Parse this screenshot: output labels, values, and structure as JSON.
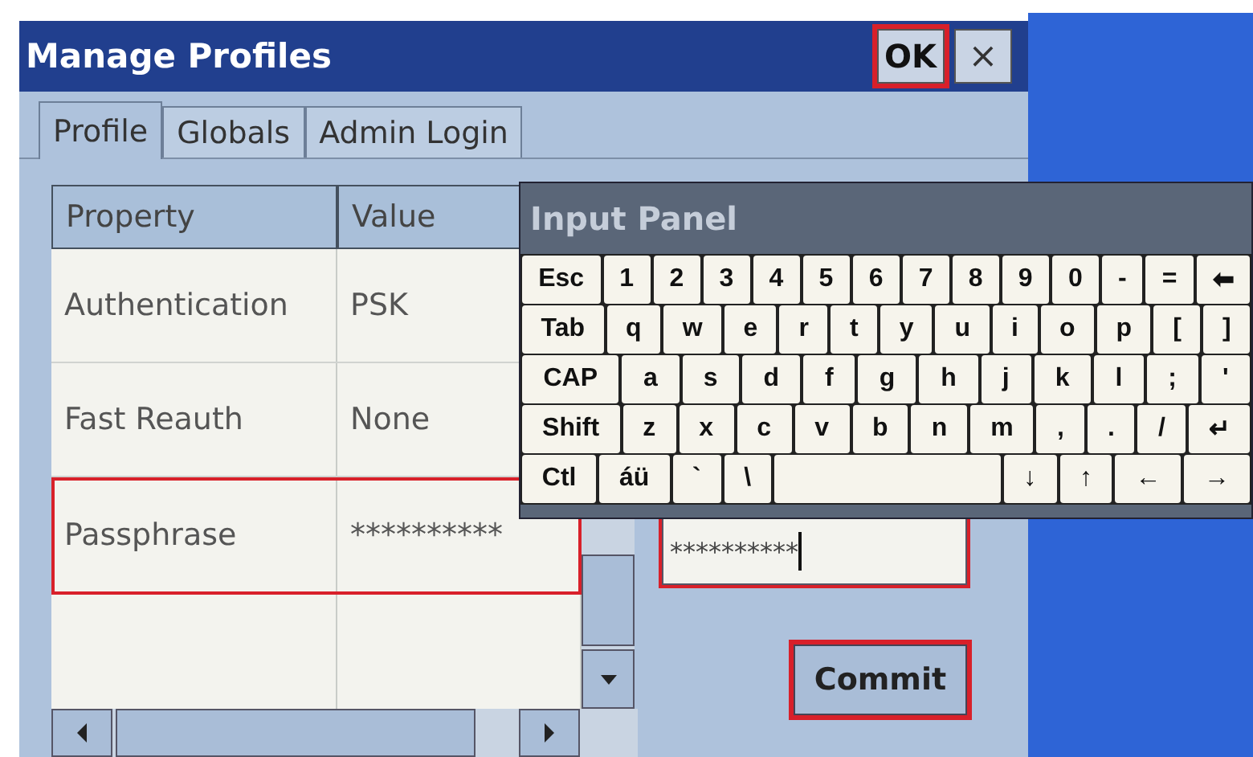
{
  "window": {
    "title": "Manage Profiles",
    "ok_button": {
      "label": "OK",
      "highlighted": true
    },
    "close_button": {
      "label": "×"
    }
  },
  "tabs": [
    {
      "label": "Profile",
      "selected": true
    },
    {
      "label": "Globals",
      "selected": false
    },
    {
      "label": "Admin Login",
      "selected": false
    }
  ],
  "table": {
    "columns": [
      "Property",
      "Value"
    ],
    "rows": [
      {
        "cells": [
          "Authentication",
          "PSK"
        ],
        "highlighted": false
      },
      {
        "cells": [
          "Fast Reauth",
          "None"
        ],
        "highlighted": false
      },
      {
        "cells": [
          "Passphrase",
          "**********"
        ],
        "highlighted": true
      }
    ]
  },
  "passphrase_field": {
    "value": "**********",
    "highlighted": true
  },
  "commit_button": {
    "label": "Commit",
    "highlighted": true
  },
  "input_panel": {
    "title": "Input Panel",
    "key_rows": [
      {
        "keys": [
          {
            "kind": "key",
            "label": "Esc"
          },
          {
            "kind": "key",
            "label": "1"
          },
          {
            "kind": "key",
            "label": "2"
          },
          {
            "kind": "key",
            "label": "3"
          },
          {
            "kind": "key",
            "label": "4"
          },
          {
            "kind": "key",
            "label": "5"
          },
          {
            "kind": "key",
            "label": "6"
          },
          {
            "kind": "key",
            "label": "7"
          },
          {
            "kind": "key",
            "label": "8"
          },
          {
            "kind": "key",
            "label": "9"
          },
          {
            "kind": "key",
            "label": "0"
          },
          {
            "kind": "key",
            "label": "-"
          },
          {
            "kind": "key",
            "label": "="
          },
          {
            "kind": "key",
            "label": "⬅"
          }
        ]
      },
      {
        "keys": [
          {
            "kind": "key",
            "label": "Tab"
          },
          {
            "kind": "key",
            "label": "q"
          },
          {
            "kind": "key",
            "label": "w"
          },
          {
            "kind": "key",
            "label": "e"
          },
          {
            "kind": "key",
            "label": "r"
          },
          {
            "kind": "key",
            "label": "t"
          },
          {
            "kind": "key",
            "label": "y"
          },
          {
            "kind": "key",
            "label": "u"
          },
          {
            "kind": "key",
            "label": "i"
          },
          {
            "kind": "key",
            "label": "o"
          },
          {
            "kind": "key",
            "label": "p"
          },
          {
            "kind": "key",
            "label": "["
          },
          {
            "kind": "key",
            "label": "]"
          }
        ]
      },
      {
        "keys": [
          {
            "kind": "key",
            "label": "CAP"
          },
          {
            "kind": "key",
            "label": "a"
          },
          {
            "kind": "key",
            "label": "s"
          },
          {
            "kind": "key",
            "label": "d"
          },
          {
            "kind": "key",
            "label": "f"
          },
          {
            "kind": "key",
            "label": "g"
          },
          {
            "kind": "key",
            "label": "h"
          },
          {
            "kind": "key",
            "label": "j"
          },
          {
            "kind": "key",
            "label": "k"
          },
          {
            "kind": "key",
            "label": "l"
          },
          {
            "kind": "key",
            "label": ";"
          },
          {
            "kind": "key",
            "label": "'"
          }
        ]
      },
      {
        "keys": [
          {
            "kind": "key",
            "label": "Shift"
          },
          {
            "kind": "key",
            "label": "z"
          },
          {
            "kind": "key",
            "label": "x"
          },
          {
            "kind": "key",
            "label": "c"
          },
          {
            "kind": "key",
            "label": "v"
          },
          {
            "kind": "key",
            "label": "b"
          },
          {
            "kind": "key",
            "label": "n"
          },
          {
            "kind": "key",
            "label": "m"
          },
          {
            "kind": "key",
            "label": ","
          },
          {
            "kind": "key",
            "label": "."
          },
          {
            "kind": "key",
            "label": "/"
          },
          {
            "kind": "key",
            "label": "↵"
          }
        ]
      },
      {
        "keys": [
          {
            "kind": "key",
            "label": "Ctl"
          },
          {
            "kind": "key",
            "label": "áü"
          },
          {
            "kind": "key",
            "label": "`"
          },
          {
            "kind": "key",
            "label": "\\"
          },
          {
            "kind": "space"
          },
          {
            "kind": "key",
            "label": "↓"
          },
          {
            "kind": "key",
            "label": "↑"
          },
          {
            "kind": "key",
            "label": "←"
          },
          {
            "kind": "key",
            "label": "→"
          }
        ]
      }
    ]
  }
}
